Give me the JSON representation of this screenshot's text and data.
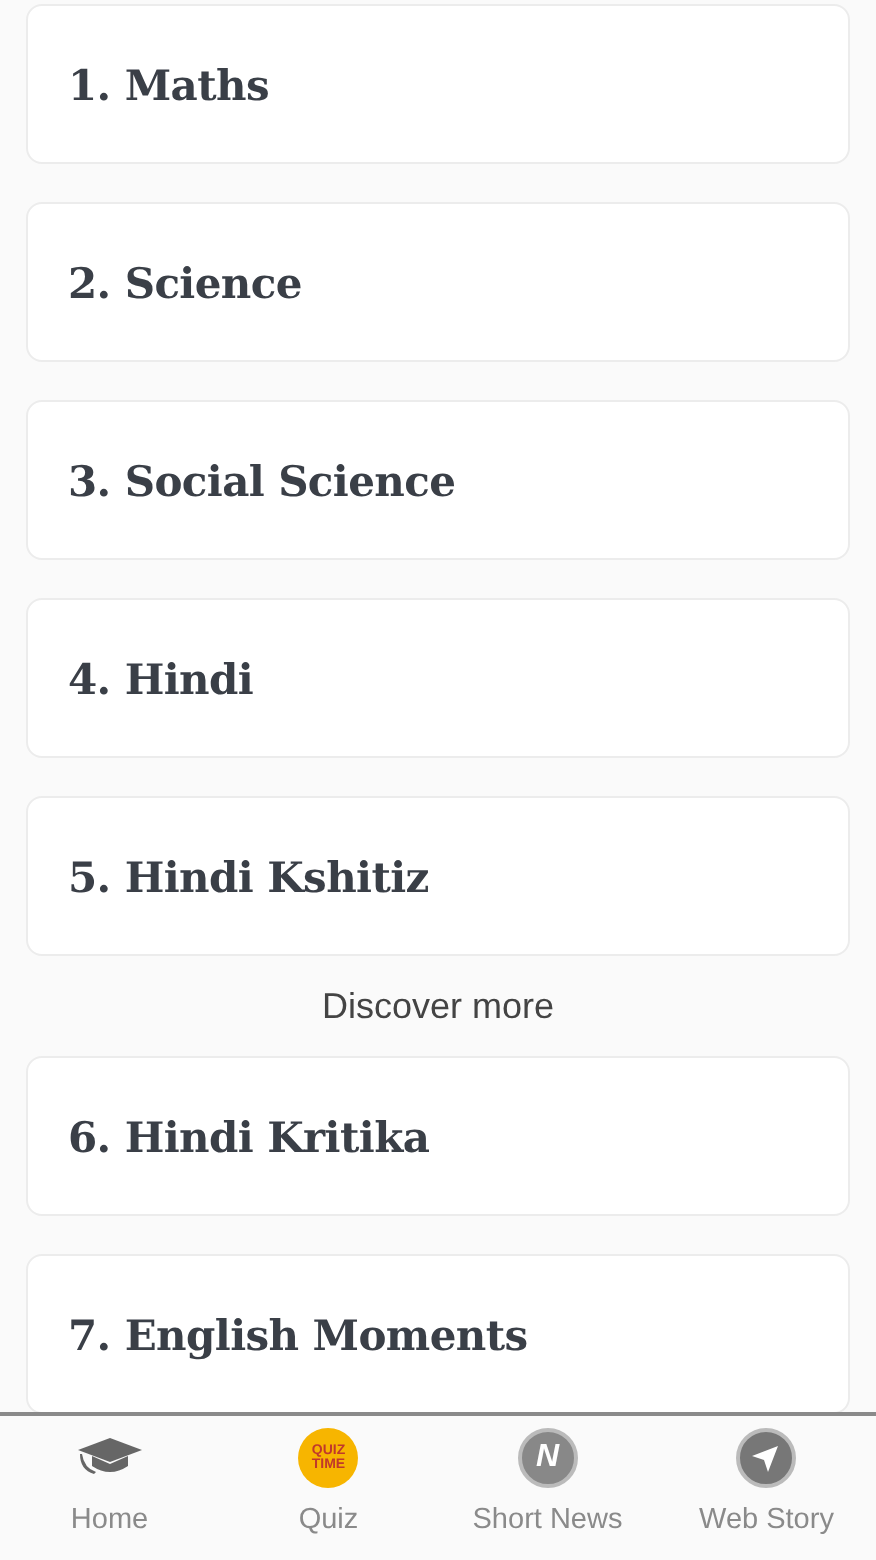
{
  "subjects": [
    {
      "label": "1. Maths"
    },
    {
      "label": "2. Science"
    },
    {
      "label": "3. Social Science"
    },
    {
      "label": "4. Hindi"
    },
    {
      "label": "5. Hindi Kshitiz"
    },
    {
      "kind": "link",
      "label": "Discover more"
    },
    {
      "label": "6. Hindi Kritika"
    },
    {
      "label": "7. English Moments"
    }
  ],
  "bottom_nav": [
    {
      "kind": "cap",
      "label": "Home"
    },
    {
      "kind": "quiz",
      "label": "Quiz",
      "icon_text": [
        "QUIZ",
        "TIME"
      ]
    },
    {
      "kind": "news",
      "label": "Short News",
      "icon_text": [
        "N"
      ]
    },
    {
      "kind": "plane",
      "label": "Web Story"
    }
  ]
}
